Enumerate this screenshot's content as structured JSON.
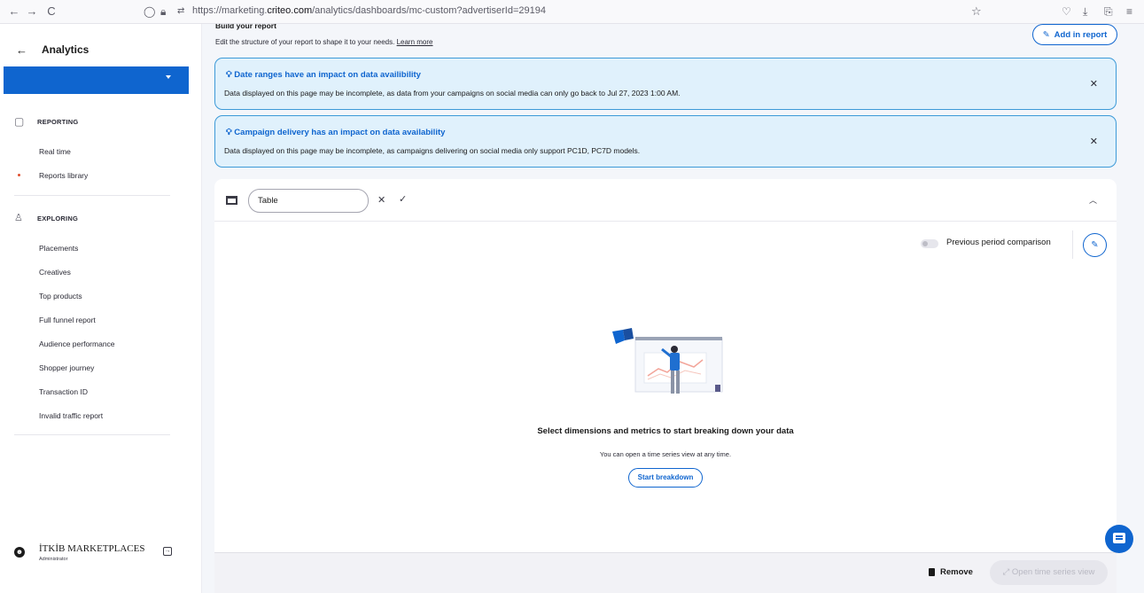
{
  "browser": {
    "nav_back": "←",
    "nav_forward": "→",
    "nav_reload": "C",
    "url_prefix": "https://marketing.",
    "url_domain": "criteo.com",
    "url_path": "/analytics/dashboards/mc-custom?advertiserId=29194"
  },
  "sidebar": {
    "back_arrow": "←",
    "title": "Analytics",
    "sections": [
      {
        "label": "REPORTING",
        "items": [
          "Real time",
          "Reports library"
        ]
      },
      {
        "label": "EXPLORING",
        "items": [
          "Placements",
          "Creatives",
          "Top products",
          "Full funnel report",
          "Audience performance",
          "Shopper journey",
          "Transaction ID",
          "Invalid traffic report"
        ]
      }
    ],
    "active_item": "Reports library",
    "user_name": "İTKİB MARKETPLACES",
    "user_role": "Administrator"
  },
  "header": {
    "build_title": "Build your report",
    "build_subtitle": "Edit the structure of your report to shape it to your needs.",
    "learn_more": "Learn more",
    "add_in_report": "Add in report"
  },
  "banners": [
    {
      "title": "Date ranges have an impact on data availibility",
      "body": "Data displayed on this page may be incomplete, as data from your campaigns on social media can only go back to Jul 27, 2023 1:00 AM."
    },
    {
      "title": "Campaign delivery has an impact on data availability",
      "body": "Data displayed on this page may be incomplete, as campaigns delivering on social media only support PC1D, PC7D models."
    }
  ],
  "card": {
    "name_value": "Table",
    "comparison_label": "Previous period comparison",
    "comparison_enabled": false,
    "empty_title": "Select dimensions and metrics to start breaking down your data",
    "empty_subtitle": "You can open a time series view at any time.",
    "start_button": "Start breakdown",
    "remove_label": "Remove",
    "open_ts_label": "Open time series view"
  },
  "colors": {
    "accent": "#0f65cf",
    "banner_bg": "#e0f1fc",
    "banner_border": "#3c9ad8",
    "active_dot": "#e0502f"
  }
}
